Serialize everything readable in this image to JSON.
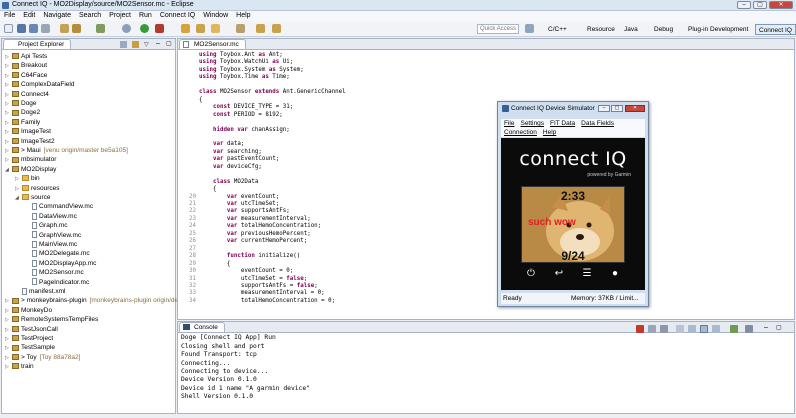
{
  "window": {
    "title": "Connect IQ - MO2Display/source/MO2Sensor.mc - Eclipse"
  },
  "menu": [
    "File",
    "Edit",
    "Navigate",
    "Search",
    "Project",
    "Run",
    "Connect IQ",
    "Window",
    "Help"
  ],
  "quick_access": {
    "placeholder": "Quick Access"
  },
  "perspectives": [
    "C/C++",
    "Resource",
    "Java",
    "Debug",
    "Plug-in Development",
    "Connect IQ"
  ],
  "project_explorer": {
    "title": "Project Explorer",
    "items": [
      {
        "label": "Api Tests",
        "level": 0,
        "kind": "project"
      },
      {
        "label": "Breakout",
        "level": 0,
        "kind": "project"
      },
      {
        "label": "C64Face",
        "level": 0,
        "kind": "project"
      },
      {
        "label": "ComplexDataField",
        "level": 0,
        "kind": "project"
      },
      {
        "label": "Connect4",
        "level": 0,
        "kind": "project"
      },
      {
        "label": "Doge",
        "level": 0,
        "kind": "project"
      },
      {
        "label": "Doge2",
        "level": 0,
        "kind": "project"
      },
      {
        "label": "Family",
        "level": 0,
        "kind": "project"
      },
      {
        "label": "ImageTest",
        "level": 0,
        "kind": "project"
      },
      {
        "label": "ImageTest2",
        "level": 0,
        "kind": "project"
      },
      {
        "label": "> Maui",
        "extra": "[venu origin/master be5a105]",
        "level": 0,
        "kind": "project"
      },
      {
        "label": "mbsimulator",
        "level": 0,
        "kind": "project"
      },
      {
        "label": "MO2Display",
        "level": 0,
        "kind": "project",
        "open": true
      },
      {
        "label": "bin",
        "level": 1,
        "kind": "folder"
      },
      {
        "label": "resources",
        "level": 1,
        "kind": "folder"
      },
      {
        "label": "source",
        "level": 1,
        "kind": "folder",
        "open": true
      },
      {
        "label": "CommandView.mc",
        "level": 2,
        "kind": "file"
      },
      {
        "label": "DataView.mc",
        "level": 2,
        "kind": "file"
      },
      {
        "label": "Graph.mc",
        "level": 2,
        "kind": "file"
      },
      {
        "label": "GraphView.mc",
        "level": 2,
        "kind": "file"
      },
      {
        "label": "MainView.mc",
        "level": 2,
        "kind": "file"
      },
      {
        "label": "MO2Delegate.mc",
        "level": 2,
        "kind": "file"
      },
      {
        "label": "MO2DisplayApp.mc",
        "level": 2,
        "kind": "file"
      },
      {
        "label": "MO2Sensor.mc",
        "level": 2,
        "kind": "file"
      },
      {
        "label": "PageIndicator.mc",
        "level": 2,
        "kind": "file"
      },
      {
        "label": "manifest.xml",
        "level": 1,
        "kind": "file"
      },
      {
        "label": "> monkeybrains-plugin",
        "extra": "[monkeybrains-plugin origin/de",
        "level": 0,
        "kind": "project"
      },
      {
        "label": "MonkeyDo",
        "level": 0,
        "kind": "project"
      },
      {
        "label": "RemoteSystemsTempFiles",
        "level": 0,
        "kind": "project"
      },
      {
        "label": "TestJsonCall",
        "level": 0,
        "kind": "project"
      },
      {
        "label": "TestProject",
        "level": 0,
        "kind": "project"
      },
      {
        "label": "TestSample",
        "level": 0,
        "kind": "project"
      },
      {
        "label": "> Toy",
        "extra": "[Toy 88a78a2]",
        "level": 0,
        "kind": "project"
      },
      {
        "label": "train",
        "level": 0,
        "kind": "project"
      }
    ]
  },
  "editor": {
    "tab": "MO2Sensor.mc",
    "lines": [
      {
        "n": "",
        "t": "using Toybox.Ant as Ant;"
      },
      {
        "n": "",
        "t": "using Toybox.WatchUi as Ui;"
      },
      {
        "n": "",
        "t": "using Toybox.System as System;"
      },
      {
        "n": "",
        "t": "using Toybox.Time as Time;"
      },
      {
        "n": "",
        "t": ""
      },
      {
        "n": "",
        "t": "class MO2Sensor extends Ant.GenericChannel"
      },
      {
        "n": "",
        "t": "{"
      },
      {
        "n": "",
        "t": "    const DEVICE_TYPE = 31;"
      },
      {
        "n": "",
        "t": "    const PERIOD = 8192;"
      },
      {
        "n": "",
        "t": ""
      },
      {
        "n": "",
        "t": "    hidden var chanAssign;"
      },
      {
        "n": "",
        "t": ""
      },
      {
        "n": "",
        "t": "    var data;"
      },
      {
        "n": "",
        "t": "    var searching;"
      },
      {
        "n": "",
        "t": "    var pastEventCount;"
      },
      {
        "n": "",
        "t": "    var deviceCfg;"
      },
      {
        "n": "",
        "t": ""
      },
      {
        "n": "",
        "t": "    class MO2Data"
      },
      {
        "n": "",
        "t": "    {"
      },
      {
        "n": "20",
        "t": "        var eventCount;"
      },
      {
        "n": "21",
        "t": "        var utcTimeSet;"
      },
      {
        "n": "22",
        "t": "        var supportsAntFs;"
      },
      {
        "n": "23",
        "t": "        var measurementInterval;"
      },
      {
        "n": "24",
        "t": "        var totalHemoConcentration;"
      },
      {
        "n": "25",
        "t": "        var previousHemoPercent;"
      },
      {
        "n": "26",
        "t": "        var currentHemoPercent;"
      },
      {
        "n": "27",
        "t": ""
      },
      {
        "n": "28",
        "t": "        function initialize()"
      },
      {
        "n": "29",
        "t": "        {"
      },
      {
        "n": "30",
        "t": "            eventCount = 0;"
      },
      {
        "n": "31",
        "t": "            utcTimeSet = false;"
      },
      {
        "n": "32",
        "t": "            supportsAntFs = false;"
      },
      {
        "n": "33",
        "t": "            measurementInterval = 0;"
      },
      {
        "n": "34",
        "t": "            totalHemoConcentration = 0;"
      }
    ]
  },
  "console": {
    "tab": "Console",
    "header": "Doge [Connect IQ App] Run",
    "lines": [
      "Closing shell and port",
      "Found Transport: tcp",
      "Connecting...",
      "Connecting to device...",
      "Device Version 0.1.0",
      "Device id 1 name \"A garmin device\"",
      "Shell Version 0.1.0"
    ]
  },
  "simulator": {
    "title": "Connect IQ Device Simulator",
    "menu1": [
      "File",
      "Settings",
      "FIT Data",
      "Data Fields"
    ],
    "menu2": [
      "Connection",
      "Help"
    ],
    "logo": "connect IQ",
    "powered": "powered by Garmin",
    "screen": {
      "time": "2:33",
      "text": "such wow",
      "date": "9/24"
    },
    "status_left": "Ready",
    "status_right": "Memory: 37KB / Limit..."
  }
}
